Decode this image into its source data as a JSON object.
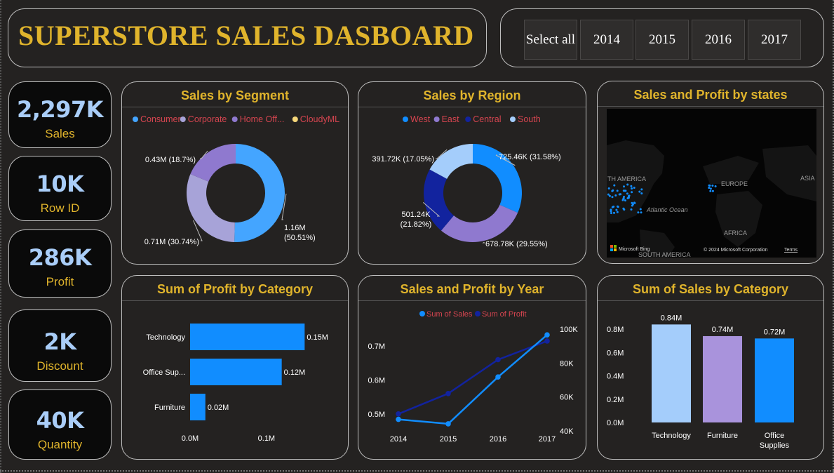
{
  "title": "SUPERSTORE SALES DASBOARD",
  "slicer": {
    "options": [
      "Select all",
      "2014",
      "2015",
      "2016",
      "2017"
    ]
  },
  "kpis": [
    {
      "value": "2,297K",
      "label": "Sales"
    },
    {
      "value": "10K",
      "label": "Row ID"
    },
    {
      "value": "286K",
      "label": "Profit"
    },
    {
      "value": "2K",
      "label": "Discount"
    },
    {
      "value": "40K",
      "label": "Quantity"
    }
  ],
  "colors": {
    "accent": "#e0b42c",
    "kpi_value": "#a9cdf8",
    "blue": "#118dff",
    "navy": "#12239e",
    "light_blue": "#a4cdfb",
    "purple": "#8f79cf",
    "lavender": "#a7a3d8",
    "legend_text": "#d64550"
  },
  "map": {
    "title": "Sales and Profit by states",
    "labels": {
      "na": "TH AMERICA",
      "europe": "EUROPE",
      "asia": "ASIA",
      "ocean": "Atlantic Ocean",
      "africa": "AFRICA",
      "sa": "SOUTH AMERICA"
    },
    "attribution": "© 2024 Microsoft Corporation",
    "terms": "Terms",
    "provider": "Microsoft Bing"
  },
  "chart_data": [
    {
      "id": "segment",
      "type": "pie",
      "title": "Sales by Segment",
      "legend": [
        "Consumer",
        "Corporate",
        "Home Off...",
        "CloudyML"
      ],
      "slices": [
        {
          "name": "Consumer",
          "value": 1.16,
          "label_line1": "1.16M",
          "label_line2": "(50.51%)",
          "color": "#44a5ff"
        },
        {
          "name": "Corporate",
          "value": 0.71,
          "label_line1": "0.71M (30.74%)",
          "label_line2": "",
          "color": "#a7a3d8"
        },
        {
          "name": "Home Office",
          "value": 0.43,
          "label_line1": "0.43M (18.7%)",
          "label_line2": "",
          "color": "#8f79cf"
        }
      ],
      "legend_colors": [
        "#44a5ff",
        "#a7a3d8",
        "#8f79cf",
        "#f6d77a"
      ]
    },
    {
      "id": "region",
      "type": "pie",
      "title": "Sales by Region",
      "legend": [
        "West",
        "East",
        "Central",
        "South"
      ],
      "slices": [
        {
          "name": "West",
          "value": 725.46,
          "label_line1": "725.46K (31.58%)",
          "label_line2": "",
          "color": "#118dff"
        },
        {
          "name": "East",
          "value": 678.78,
          "label_line1": "678.78K (29.55%)",
          "label_line2": "",
          "color": "#8f79cf"
        },
        {
          "name": "Central",
          "value": 501.24,
          "label_line1": "501.24K",
          "label_line2": "(21.82%)",
          "color": "#12239e"
        },
        {
          "name": "South",
          "value": 391.72,
          "label_line1": "391.72K (17.05%)",
          "label_line2": "",
          "color": "#a4cdfb"
        }
      ],
      "legend_colors": [
        "#118dff",
        "#8f79cf",
        "#12239e",
        "#a4cdfb"
      ]
    },
    {
      "id": "profit_category",
      "type": "bar",
      "orientation": "horizontal",
      "title": "Sum of Profit by Category",
      "categories": [
        "Technology",
        "Office Sup...",
        "Furniture"
      ],
      "values": [
        0.15,
        0.12,
        0.02
      ],
      "data_labels": [
        "0.15M",
        "0.12M",
        "0.02M"
      ],
      "x_ticks": [
        "0.0M",
        "0.1M"
      ],
      "xlim": [
        0,
        0.1543
      ]
    },
    {
      "id": "year",
      "type": "line",
      "title": "Sales and Profit by Year",
      "x": [
        "2014",
        "2015",
        "2016",
        "2017"
      ],
      "series": [
        {
          "name": "Sum of Sales",
          "values": [
            0.484,
            0.471,
            0.609,
            0.733
          ],
          "color": "#118dff",
          "axis": "left"
        },
        {
          "name": "Sum of Profit",
          "values": [
            50000,
            62000,
            82000,
            93000
          ],
          "color": "#12239e",
          "axis": "right"
        }
      ],
      "y_left_ticks": [
        "0.5M",
        "0.6M",
        "0.7M"
      ],
      "y_right_ticks": [
        "40K",
        "60K",
        "80K",
        "100K"
      ],
      "ylim_left": [
        0.45,
        0.75
      ],
      "ylim_right": [
        40000,
        100000
      ]
    },
    {
      "id": "sales_category",
      "type": "bar",
      "title": "Sum of Sales by Category",
      "categories": [
        "Technology",
        "Furniture",
        "Office Supplies"
      ],
      "values": [
        0.84,
        0.74,
        0.72
      ],
      "data_labels": [
        "0.84M",
        "0.74M",
        "0.72M"
      ],
      "colors": [
        "#a4cdfb",
        "#a993dc",
        "#118dff"
      ],
      "y_ticks": [
        "0.0M",
        "0.2M",
        "0.4M",
        "0.6M",
        "0.8M"
      ],
      "ylim": [
        0,
        0.8
      ]
    }
  ]
}
